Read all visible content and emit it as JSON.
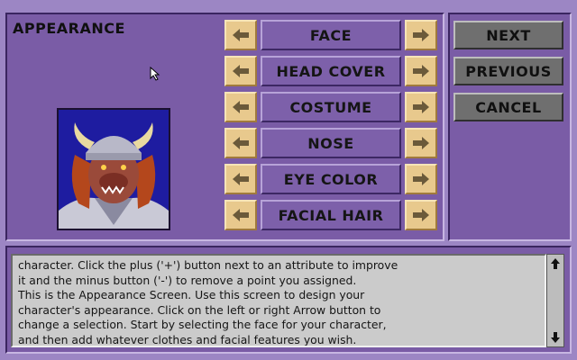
{
  "screen": {
    "title": "APPEARANCE"
  },
  "attributes": [
    {
      "label": "FACE"
    },
    {
      "label": "HEAD COVER"
    },
    {
      "label": "COSTUME"
    },
    {
      "label": "NOSE"
    },
    {
      "label": "EYE COLOR"
    },
    {
      "label": "FACIAL HAIR"
    }
  ],
  "nav": {
    "next_label": "NEXT",
    "previous_label": "PREVIOUS",
    "cancel_label": "CANCEL"
  },
  "help": {
    "lines": [
      "character.  Click the plus ('+') button next to an attribute to improve",
      "it and the minus button ('-') to remove a point you assigned.",
      "This is the Appearance Screen. Use this screen to design your",
      "character's appearance.  Click on the left or right Arrow button to",
      "change a selection. Start by selecting the face for your character,",
      "and then add whatever clothes and facial features you wish."
    ]
  },
  "icons": {
    "arrow_left": "arrow-left-icon",
    "arrow_right": "arrow-right-icon",
    "cursor": "mouse-pointer-icon",
    "scroll_up": "scroll-up-icon",
    "scroll_down": "scroll-down-icon"
  },
  "colors": {
    "background": "#9c86c4",
    "panel": "#7a5ca6",
    "arrow_button": "#e8c98d",
    "nav_button": "#6f6f6f",
    "help_box": "#cbcbcb"
  }
}
